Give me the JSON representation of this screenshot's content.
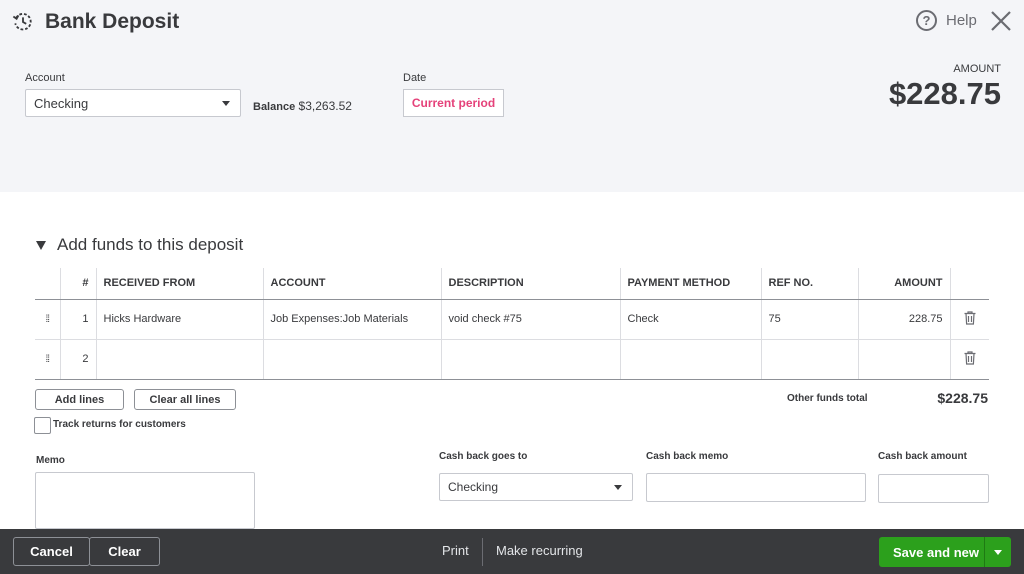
{
  "header": {
    "title": "Bank Deposit",
    "help_label": "Help",
    "account_label": "Account",
    "account_value": "Checking",
    "balance_label": "Balance",
    "balance_value": "$3,263.52",
    "date_label": "Date",
    "date_value": "Current period",
    "amount_label": "AMOUNT",
    "amount_value": "$228.75"
  },
  "section": {
    "title": "Add funds to this deposit"
  },
  "table": {
    "columns": [
      "#",
      "RECEIVED FROM",
      "ACCOUNT",
      "DESCRIPTION",
      "PAYMENT METHOD",
      "REF NO.",
      "AMOUNT"
    ],
    "rows": [
      {
        "num": "1",
        "received_from": "Hicks Hardware",
        "account": "Job Expenses:Job Materials",
        "description": "void check #75",
        "payment_method": "Check",
        "ref_no": "75",
        "amount": "228.75"
      },
      {
        "num": "2",
        "received_from": "",
        "account": "",
        "description": "",
        "payment_method": "",
        "ref_no": "",
        "amount": ""
      }
    ]
  },
  "controls": {
    "add_lines": "Add lines",
    "clear_all_lines": "Clear all lines",
    "other_funds_label": "Other funds total",
    "other_funds_value": "$228.75",
    "track_returns_label": "Track returns for customers"
  },
  "lower": {
    "memo_label": "Memo",
    "cash_back_goes_to_label": "Cash back goes to",
    "cash_back_goes_to_value": "Checking",
    "cash_back_memo_label": "Cash back memo",
    "cash_back_amount_label": "Cash back amount"
  },
  "footer": {
    "cancel": "Cancel",
    "clear": "Clear",
    "print": "Print",
    "make_recurring": "Make recurring",
    "save_and_new": "Save and new"
  }
}
